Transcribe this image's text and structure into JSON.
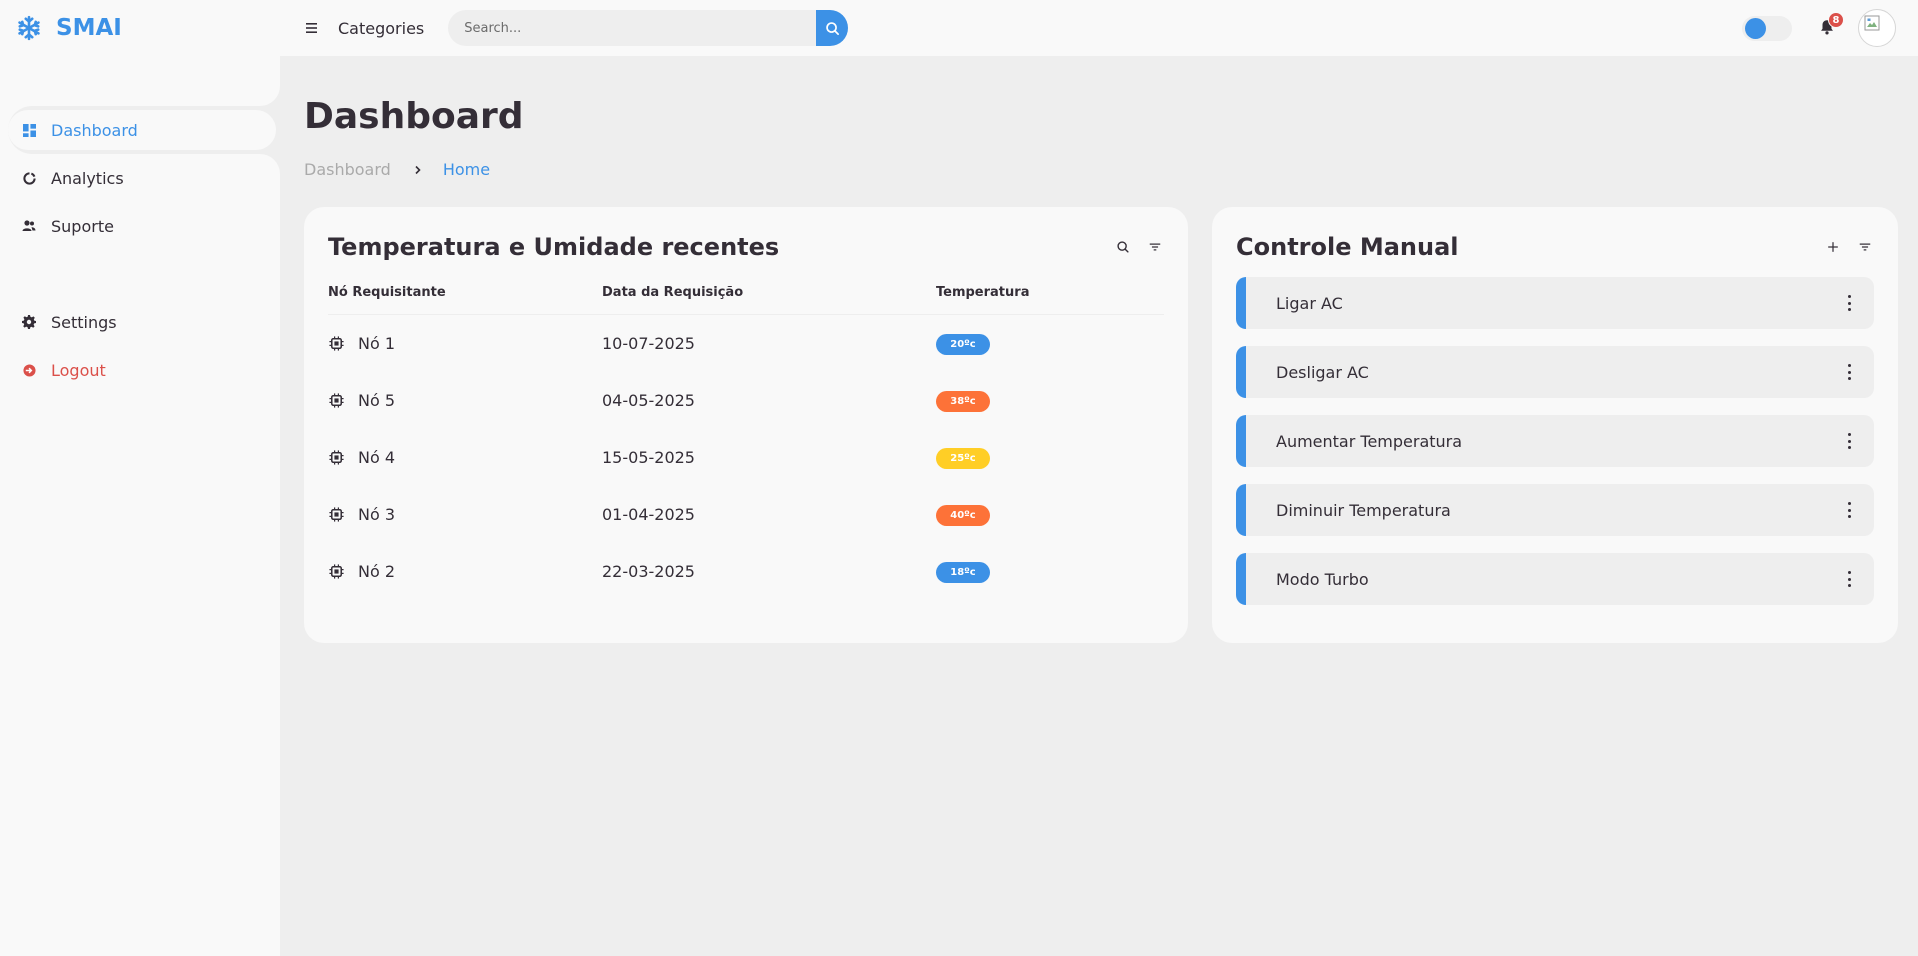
{
  "brand": {
    "name": "SMAI",
    "icon": "snowflake-icon"
  },
  "sidebar": {
    "items": [
      {
        "label": "Dashboard",
        "icon": "dashboard-icon",
        "active": true
      },
      {
        "label": "Analytics",
        "icon": "pie-chart-icon",
        "active": false
      },
      {
        "label": "Suporte",
        "icon": "users-icon",
        "active": false
      }
    ],
    "bottom_items": [
      {
        "label": "Settings",
        "icon": "gear-icon"
      },
      {
        "label": "Logout",
        "icon": "logout-icon"
      }
    ]
  },
  "navbar": {
    "categories_label": "Categories",
    "search_placeholder": "Search...",
    "notification_count": "8"
  },
  "main": {
    "title": "Dashboard",
    "breadcrumb": [
      "Dashboard",
      "Home"
    ]
  },
  "recent_card": {
    "title": "Temperatura e Umidade recentes",
    "columns": [
      "Nó Requisitante",
      "Data da Requisição",
      "Temperatura"
    ],
    "rows": [
      {
        "node": "Nó 1",
        "date": "10-07-2025",
        "temp": "20ºc",
        "status": "normal"
      },
      {
        "node": "Nó 5",
        "date": "04-05-2025",
        "temp": "38ºc",
        "status": "hot"
      },
      {
        "node": "Nó 4",
        "date": "15-05-2025",
        "temp": "25ºc",
        "status": "warm"
      },
      {
        "node": "Nó 3",
        "date": "01-04-2025",
        "temp": "40ºc",
        "status": "hot"
      },
      {
        "node": "Nó 2",
        "date": "22-03-2025",
        "temp": "18ºc",
        "status": "normal"
      }
    ]
  },
  "control_card": {
    "title": "Controle Manual",
    "items": [
      "Ligar AC",
      "Desligar AC",
      "Aumentar Temperatura",
      "Diminuir Temperatura",
      "Modo Turbo"
    ]
  },
  "colors": {
    "accent": "#3c91e6",
    "hot": "#fd7238",
    "warm": "#ffce26",
    "danger": "#db504a",
    "background": "#eeeeee",
    "surface": "#f9f9f9"
  }
}
